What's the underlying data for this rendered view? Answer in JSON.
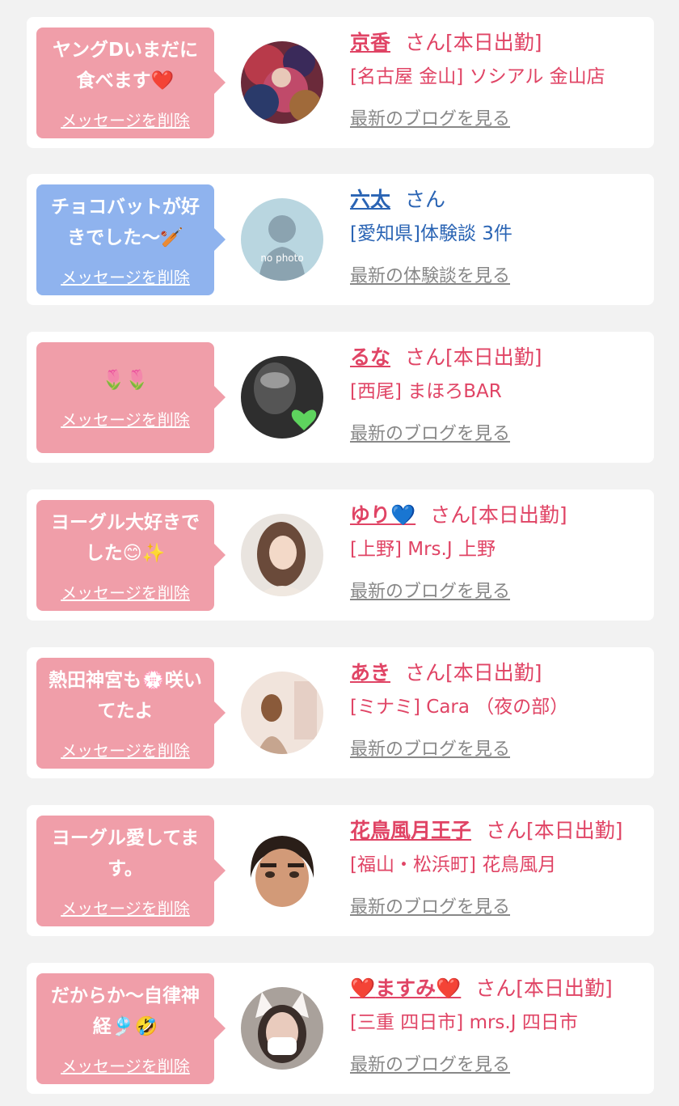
{
  "items": [
    {
      "message_lines": [
        "ヤングDいまだに",
        "食べます"
      ],
      "message_emoji": "❤️",
      "delete_label": "メッセージを削除",
      "name": "京香",
      "suffix": "さん[本日出勤]",
      "shop": "[名古屋 金山] ソシアル 金山店",
      "link": "最新のブログを見る"
    },
    {
      "message_lines": [
        "チョコバットが好",
        "きでした〜"
      ],
      "message_emoji": "🏏",
      "delete_label": "メッセージを削除",
      "name": "六太",
      "suffix": "さん",
      "shop": "[愛知県]体験談 3件",
      "link": "最新の体験談を見る",
      "avatar_text": "no photo"
    },
    {
      "message_emoji": "🌷🌷",
      "delete_label": "メッセージを削除",
      "name": "るな",
      "suffix": "さん[本日出勤]",
      "shop": "[西尾] まほろBAR",
      "link": "最新のブログを見る"
    },
    {
      "message_lines": [
        "ヨーグル大好きで",
        "した"
      ],
      "message_emoji": "😊✨",
      "delete_label": "メッセージを削除",
      "name": "ゆり",
      "name_emoji": "💙",
      "suffix": "さん[本日出勤]",
      "shop": "[上野] Mrs.J 上野",
      "link": "最新のブログを見る"
    },
    {
      "message_lines": [
        "熱田神宮も",
        "咲い",
        "てたよ"
      ],
      "message_emoji": "💮",
      "delete_label": "メッセージを削除",
      "name": "あき",
      "suffix": "さん[本日出勤]",
      "shop": "[ミナミ] Cara （夜の部）",
      "link": "最新のブログを見る"
    },
    {
      "message_lines": [
        "ヨーグル愛してま",
        "す。"
      ],
      "delete_label": "メッセージを削除",
      "name": "花鳥風月王子",
      "suffix": "さん[本日出勤]",
      "shop": "[福山・松浜町] 花鳥風月",
      "link": "最新のブログを見る"
    },
    {
      "message_lines": [
        "だからか〜自律神",
        "経"
      ],
      "message_emoji": "🎐🤣",
      "delete_label": "メッセージを削除",
      "name": "ますみ",
      "name_hearts": "❤️",
      "suffix": "さん[本日出勤]",
      "shop": "[三重 四日市] mrs.J 四日市",
      "link": "最新のブログを見る"
    }
  ],
  "colors": {
    "pink_bubble": "#f09ea9",
    "blue_bubble": "#8fb3ee",
    "pink_text": "#e04465",
    "blue_text": "#2a64b4",
    "link_gray": "#888888",
    "page_bg": "#f2f2f2"
  }
}
